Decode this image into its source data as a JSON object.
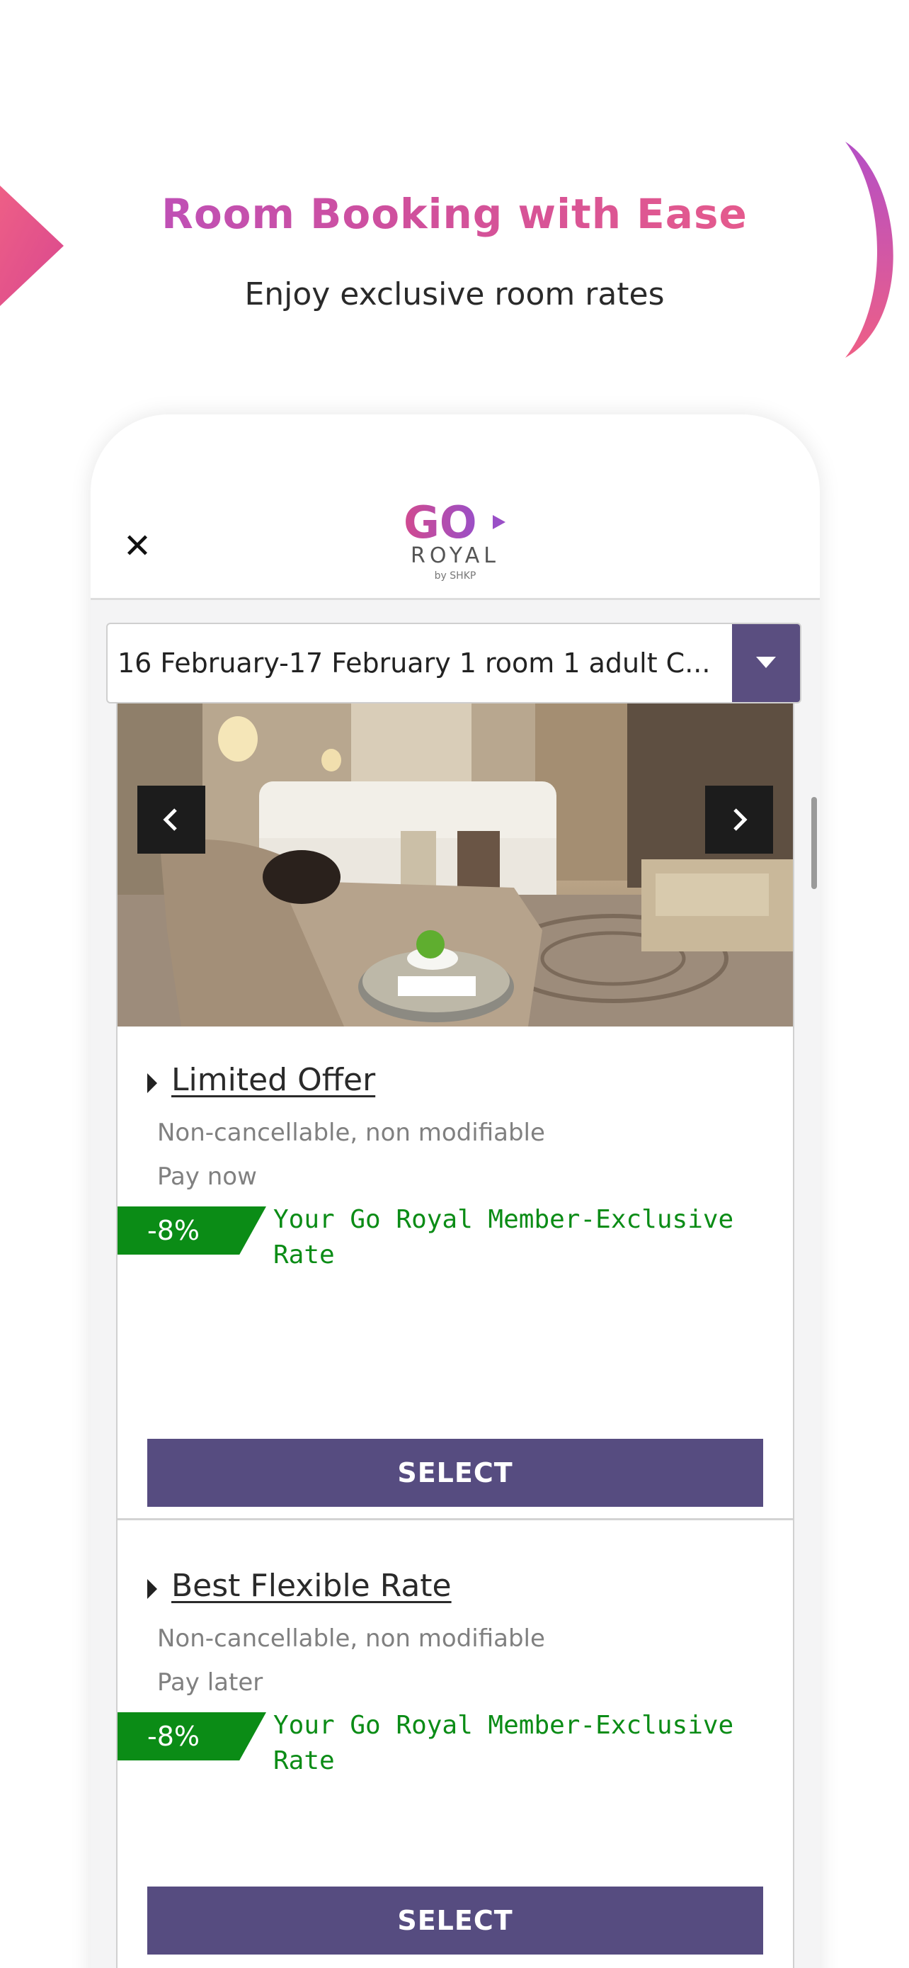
{
  "hero": {
    "title": "Room Booking with Ease",
    "subtitle": "Enjoy exclusive room rates",
    "gradient_start": "#b44fc6",
    "gradient_end": "#ee5f86"
  },
  "app_header": {
    "close_icon": "close-icon",
    "logo_main": "GO",
    "logo_sub": "ROYAL",
    "logo_by": "by SHKP"
  },
  "search": {
    "summary": "16 February-17 February  1 room 1 adult  C...",
    "dropdown_icon": "caret-down-icon",
    "accent": "#5a4e80"
  },
  "carousel": {
    "prev_icon": "chevron-left-icon",
    "next_icon": "chevron-right-icon"
  },
  "rates": [
    {
      "title": "Limited Offer",
      "policy": "Non-cancellable, non modifiable",
      "payment": "Pay now",
      "discount": "-8%",
      "member_text": "Your Go Royal Member-Exclusive Rate",
      "button": "SELECT"
    },
    {
      "title": "Best Flexible Rate",
      "policy": "Non-cancellable, non modifiable",
      "payment": "Pay later",
      "discount": "-8%",
      "member_text": "Your Go Royal Member-Exclusive Rate",
      "button": "SELECT"
    }
  ],
  "colors": {
    "discount_green": "#0b8c16",
    "select_purple": "#564c80"
  }
}
